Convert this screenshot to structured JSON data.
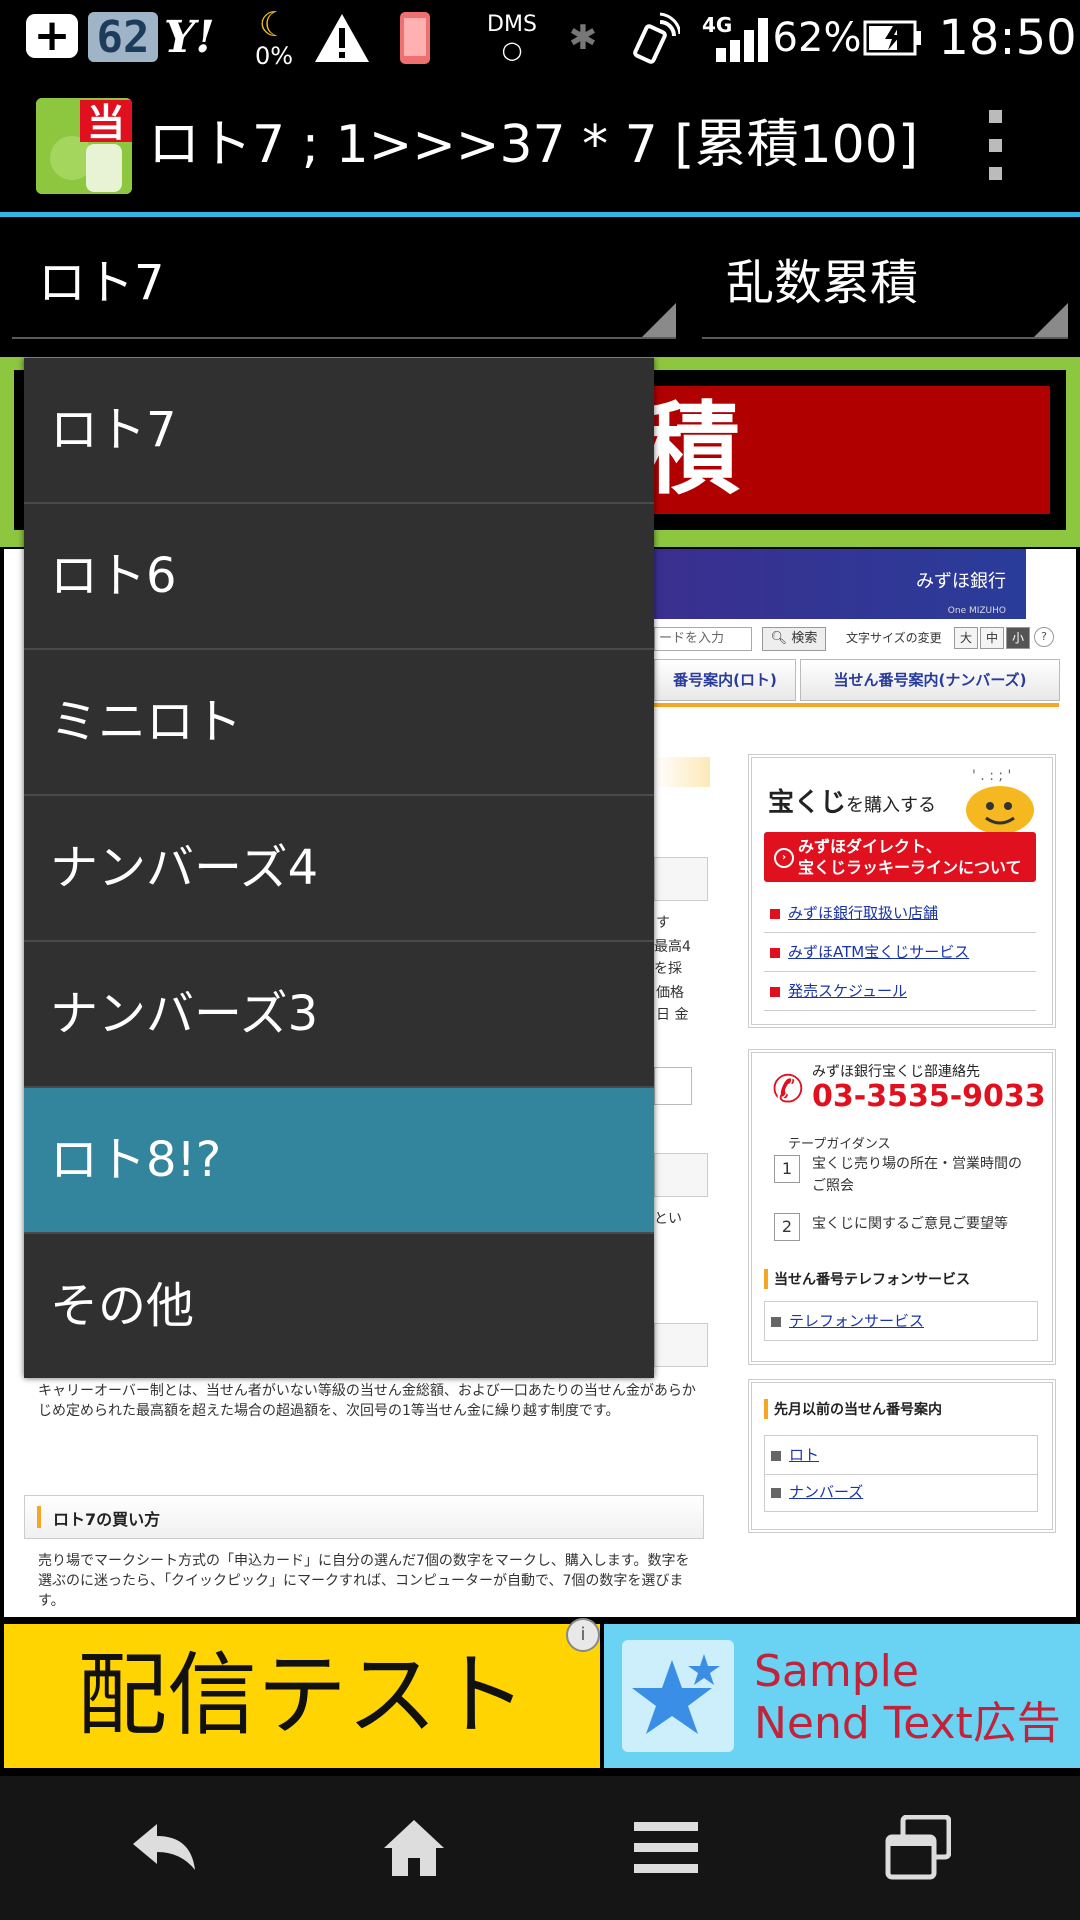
{
  "status_bar": {
    "badge_number": "62",
    "yahoo": "Y!",
    "moon_percent": "0%",
    "network_label": "DMS",
    "network_type": "4G",
    "battery_percent": "62%",
    "time": "18:50"
  },
  "action_bar": {
    "icon_char": "当",
    "title": "ロト7 ; 1>>>37 * 7 [累積100]"
  },
  "spinners": {
    "game": "ロト7",
    "mode": "乱数累積"
  },
  "banner": {
    "visible_char": "積"
  },
  "dropdown": {
    "options": [
      "ロト7",
      "ロト6",
      "ミニロト",
      "ナンバーズ4",
      "ナンバーズ3",
      "ロト8!?",
      "その他"
    ],
    "selected_index": 5
  },
  "web": {
    "bank_name": "みずほ銀行",
    "bank_sub": "One MIZUHO",
    "search_placeholder": "ードを入力",
    "search_button": "検索",
    "font_size_label": "文字サイズの変更",
    "font_sizes": [
      "大",
      "中",
      "小"
    ],
    "help": "?",
    "tab_loto": "番号案内(ロト)",
    "tab_numbers": "当せん番号案内(ナンバーズ)",
    "fragments": [
      "す",
      "最高4",
      "を採",
      "価格",
      "日 金",
      "とい"
    ],
    "takarakuji": {
      "title_main": "宝くじ",
      "title_rest": "を購入する",
      "red_button": [
        "みずほダイレクト、",
        "宝くじラッキーラインについて"
      ],
      "links": [
        "みずほ銀行取扱い店舗",
        "みずほATM宝くじサービス",
        "発売スケジュール"
      ]
    },
    "contact": {
      "title": "みずほ銀行宝くじ部連絡先",
      "phone": "03-3535-9033",
      "guidance": "テープガイダンス",
      "items": [
        {
          "num": "1",
          "text": "宝くじ売り場の所在・営業時間のご照会"
        },
        {
          "num": "2",
          "text": "宝くじに関するご意見ご要望等"
        }
      ],
      "tel_service_head": "当せん番号テレフォンサービス",
      "tel_service_link": "テレフォンサービス"
    },
    "past": {
      "head": "先月以前の当せん番号案内",
      "links": [
        "ロト",
        "ナンバーズ"
      ]
    },
    "carryover_text": "キャリーオーバー制とは、当せん者がいない等級の当せん金総額、および一口あたりの当せん金があらかじめ定められた最高額を超えた場合の超過額を、次回号の1等当せん金に繰り越す制度です。",
    "howto_head": "ロト7の買い方",
    "howto_text": "売り場でマークシート方式の「申込カード」に自分の選んだ7個の数字をマークし、購入します。数字を選ぶのに迷ったら、「クイックピック」にマークすれば、コンピューターが自動で、7個の数字を選びます。"
  },
  "ads": {
    "left_text": "配信テスト",
    "right_line1": "Sample",
    "right_line2": "Nend Text広告",
    "info": "i"
  },
  "colors": {
    "accent_blue": "#33b5e5",
    "selected_item": "#33849d",
    "banner_green": "#8dc63f",
    "banner_red": "#b00000",
    "ad_yellow": "#ffd400",
    "ad_cyan": "#6ad3f3"
  }
}
